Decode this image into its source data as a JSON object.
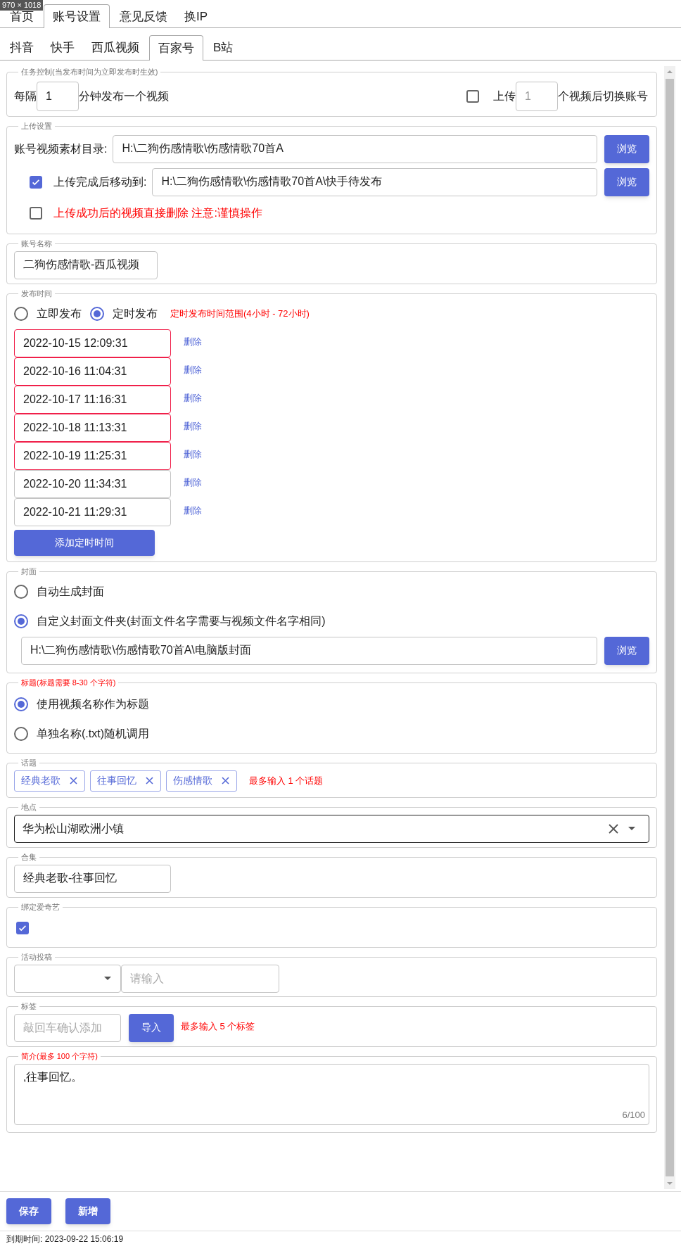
{
  "size_badge": "970 × 1018",
  "main_tabs": [
    {
      "label": "首页",
      "selected": false
    },
    {
      "label": "账号设置",
      "selected": true
    },
    {
      "label": "意见反馈",
      "selected": false
    },
    {
      "label": "换IP",
      "selected": false
    }
  ],
  "platform_tabs": [
    {
      "label": "抖音",
      "selected": false
    },
    {
      "label": "快手",
      "selected": false
    },
    {
      "label": "西瓜视频",
      "selected": false
    },
    {
      "label": "百家号",
      "selected": true
    },
    {
      "label": "B站",
      "selected": false
    }
  ],
  "task_control": {
    "legend": "任务控制(当发布时间为立即发布时生效)",
    "interval_prefix": "每隔",
    "interval_value": "1",
    "interval_suffix": "分钟发布一个视频",
    "switch_checked": false,
    "switch_prefix": "上传",
    "switch_value": "1",
    "switch_suffix": "个视频后切换账号"
  },
  "upload": {
    "legend": "上传设置",
    "dir_label": "账号视频素材目录:",
    "dir_value": "H:\\二狗伤感情歌\\伤感情歌70首A",
    "dir_browse": "浏览",
    "move_checked": true,
    "move_label": "上传完成后移动到:",
    "move_value": "H:\\二狗伤感情歌\\伤感情歌70首A\\快手待发布",
    "move_browse": "浏览",
    "delete_checked": false,
    "delete_label": "上传成功后的视频直接删除 注意:谨慎操作"
  },
  "account_name": {
    "legend": "账号名称",
    "value": "二狗伤感情歌-西瓜视频"
  },
  "publish_time": {
    "legend": "发布时间",
    "options": [
      {
        "label": "立即发布",
        "selected": false
      },
      {
        "label": "定时发布",
        "selected": true
      }
    ],
    "hint": "定时发布时间范围(4小时 - 72小时)",
    "times": [
      {
        "value": "2022-10-15 12:09:31",
        "invalid": true,
        "action": "删除"
      },
      {
        "value": "2022-10-16 11:04:31",
        "invalid": true,
        "action": "删除"
      },
      {
        "value": "2022-10-17 11:16:31",
        "invalid": true,
        "action": "删除"
      },
      {
        "value": "2022-10-18 11:13:31",
        "invalid": true,
        "action": "删除"
      },
      {
        "value": "2022-10-19 11:25:31",
        "invalid": true,
        "action": "删除"
      },
      {
        "value": "2022-10-20 11:34:31",
        "invalid": false,
        "action": "删除"
      },
      {
        "value": "2022-10-21 11:29:31",
        "invalid": false,
        "action": "删除"
      }
    ],
    "add_button": "添加定时时间"
  },
  "cover": {
    "legend": "封面",
    "options": [
      {
        "label": "自动生成封面",
        "selected": false
      },
      {
        "label": "自定义封面文件夹(封面文件名字需要与视频文件名字相同)",
        "selected": true
      }
    ],
    "path": "H:\\二狗伤感情歌\\伤感情歌70首A\\电脑版封面",
    "browse": "浏览"
  },
  "title": {
    "legend": "标题(标题需要 8-30 个字符)",
    "legend_alert": true,
    "options": [
      {
        "label": "使用视频名称作为标题",
        "selected": true
      },
      {
        "label": "单独名称(.txt)随机调用",
        "selected": false
      }
    ]
  },
  "topics": {
    "legend": "话题",
    "tags": [
      "经典老歌",
      "往事回忆",
      "伤感情歌"
    ],
    "hint": "最多输入 1 个话题"
  },
  "location": {
    "legend": "地点",
    "value": "华为松山湖欧洲小镇"
  },
  "collection": {
    "legend": "合集",
    "value": "经典老歌-往事回忆"
  },
  "iqiyi": {
    "legend": "绑定爱奇艺",
    "checked": true
  },
  "activity": {
    "legend": "活动投稿",
    "placeholder": "请输入"
  },
  "tags": {
    "legend": "标签",
    "placeholder": "敲回车确认添加",
    "import_button": "导入",
    "hint": "最多输入 5 个标签"
  },
  "intro": {
    "legend": "简介(最多 100 个字符)",
    "legend_alert": true,
    "value": ",往事回忆。",
    "counter": "6/100"
  },
  "footer_buttons": [
    "保存",
    "新增"
  ],
  "status_bar": "到期时间: 2023-09-22 15:06:19"
}
